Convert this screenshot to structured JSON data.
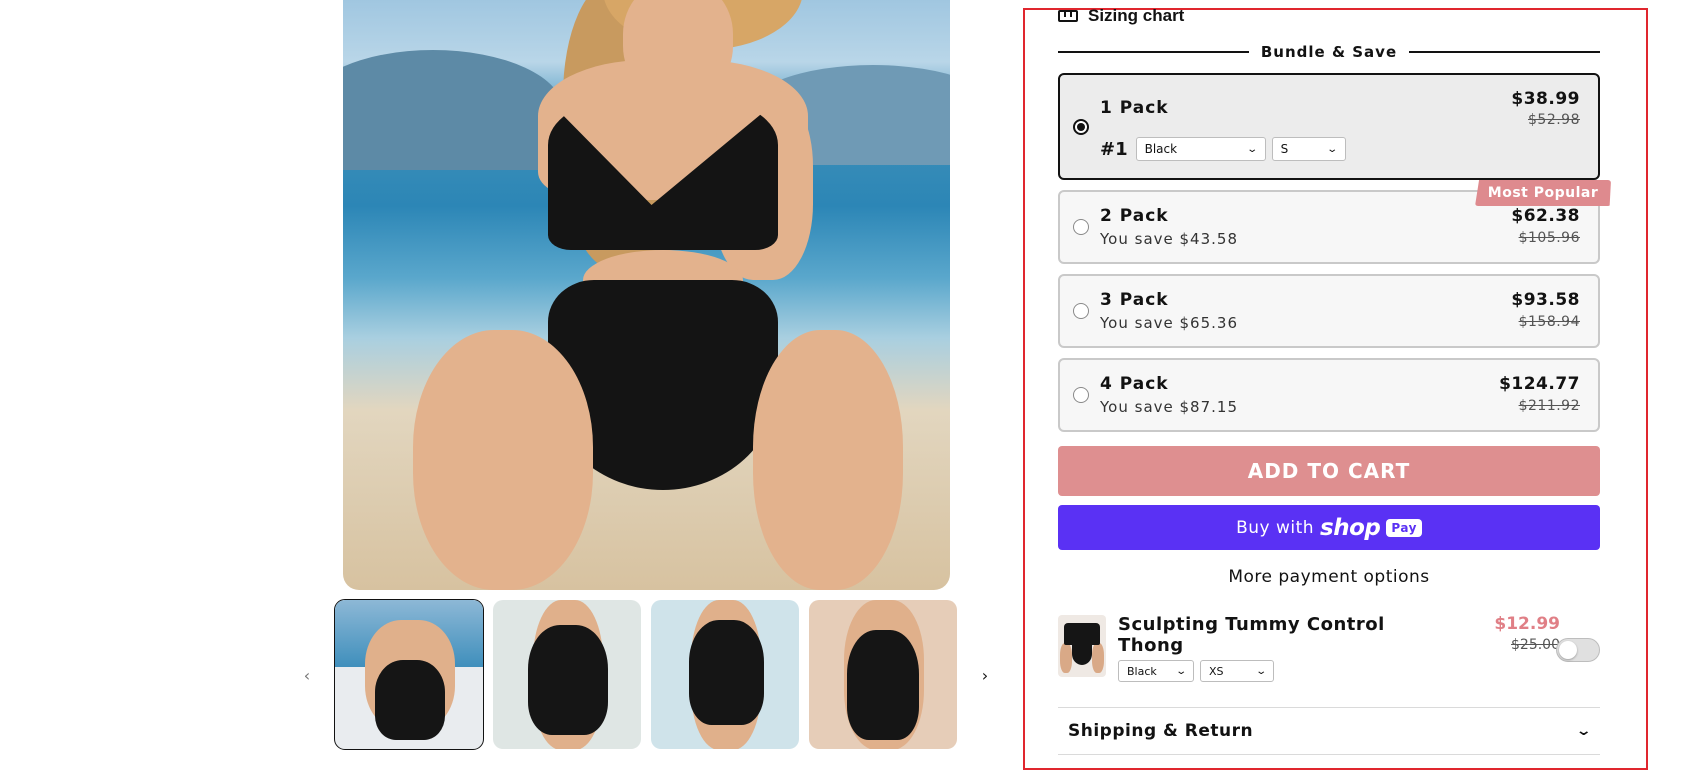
{
  "gallery": {
    "prev_icon": "chevron-left-icon",
    "next_icon": "chevron-right-icon",
    "prev_glyph": "‹",
    "next_glyph": "›"
  },
  "sizing_chart": {
    "label": "Sizing chart",
    "icon": "ruler-icon"
  },
  "bundle": {
    "heading": "Bundle & Save",
    "badge": "Most Popular",
    "packs": [
      {
        "title": "1 Pack",
        "price": "$38.99",
        "old_price": "$52.98",
        "selected": true,
        "variant_number": "#1",
        "color": "Black",
        "size": "S"
      },
      {
        "title": "2 Pack",
        "savings": "You save $43.58",
        "price": "$62.38",
        "old_price": "$105.96",
        "selected": false
      },
      {
        "title": "3 Pack",
        "savings": "You save $65.36",
        "price": "$93.58",
        "old_price": "$158.94",
        "selected": false
      },
      {
        "title": "4 Pack",
        "savings": "You save $87.15",
        "price": "$124.77",
        "old_price": "$211.92",
        "selected": false
      }
    ]
  },
  "buttons": {
    "add_to_cart": "ADD TO CART",
    "buy_with": "Buy with",
    "shop_word": "shop",
    "pay_chip": "Pay",
    "more_payment": "More payment options"
  },
  "upsell": {
    "title": "Sculpting Tummy Control Thong",
    "price": "$12.99",
    "old_price": "$25.00",
    "color": "Black",
    "size": "XS",
    "enabled": false
  },
  "accordion": {
    "label": "Shipping & Return",
    "icon": "chevron-down-icon"
  },
  "colors": {
    "accent": "#de8f90",
    "shop_pay": "#5a31f4",
    "frame": "#e0262e"
  }
}
